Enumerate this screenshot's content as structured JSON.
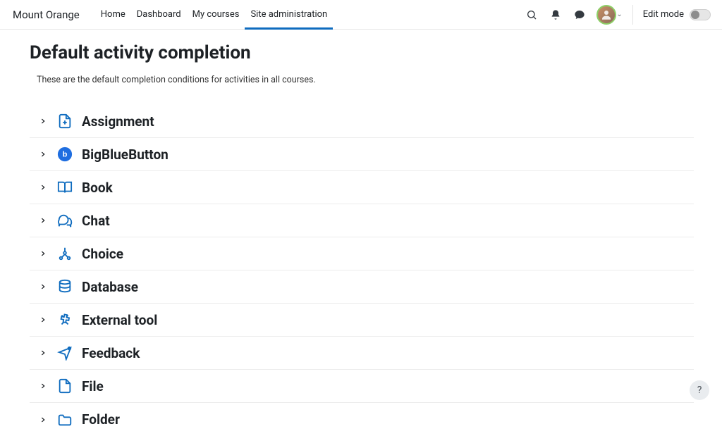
{
  "brand": "Mount Orange",
  "nav": {
    "items": [
      {
        "label": "Home",
        "active": false
      },
      {
        "label": "Dashboard",
        "active": false
      },
      {
        "label": "My courses",
        "active": false
      },
      {
        "label": "Site administration",
        "active": true
      }
    ]
  },
  "header": {
    "edit_mode_label": "Edit mode"
  },
  "page": {
    "title": "Default activity completion",
    "description": "These are the default completion conditions for activities in all courses."
  },
  "activities": [
    {
      "label": "Assignment",
      "icon": "assignment"
    },
    {
      "label": "BigBlueButton",
      "icon": "bigbluebutton"
    },
    {
      "label": "Book",
      "icon": "book"
    },
    {
      "label": "Chat",
      "icon": "chat"
    },
    {
      "label": "Choice",
      "icon": "choice"
    },
    {
      "label": "Database",
      "icon": "database"
    },
    {
      "label": "External tool",
      "icon": "externaltool"
    },
    {
      "label": "Feedback",
      "icon": "feedback"
    },
    {
      "label": "File",
      "icon": "file"
    },
    {
      "label": "Folder",
      "icon": "folder"
    }
  ],
  "help_label": "?"
}
